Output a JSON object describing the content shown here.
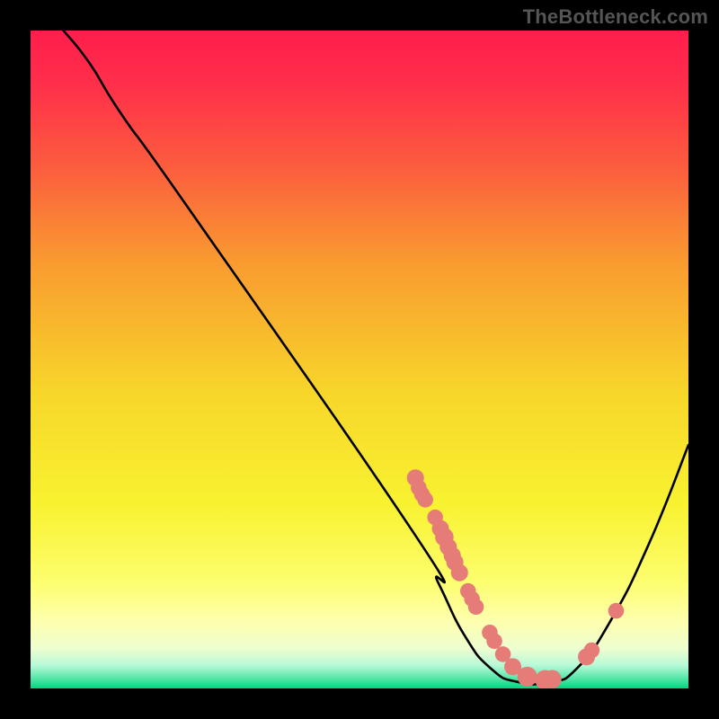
{
  "watermark": {
    "text": "TheBottleneck.com"
  },
  "colors": {
    "background": "#000000",
    "curve": "#000000",
    "marker_fill": "#E67C78",
    "marker_stroke": "#E67C78",
    "gradient_stops": [
      {
        "offset": 0.0,
        "color": "#FF1E4C"
      },
      {
        "offset": 0.08,
        "color": "#FF2E4A"
      },
      {
        "offset": 0.2,
        "color": "#FC5A3F"
      },
      {
        "offset": 0.35,
        "color": "#F99A30"
      },
      {
        "offset": 0.55,
        "color": "#F7D62A"
      },
      {
        "offset": 0.72,
        "color": "#F8F230"
      },
      {
        "offset": 0.84,
        "color": "#FDFE70"
      },
      {
        "offset": 0.9,
        "color": "#FEFFB0"
      },
      {
        "offset": 0.94,
        "color": "#EDFED0"
      },
      {
        "offset": 0.965,
        "color": "#B7F9D7"
      },
      {
        "offset": 0.985,
        "color": "#53E6A7"
      },
      {
        "offset": 1.0,
        "color": "#00D681"
      }
    ]
  },
  "chart_data": {
    "type": "line",
    "title": "",
    "xlabel": "",
    "ylabel": "",
    "xlim": [
      0,
      100
    ],
    "ylim": [
      0,
      100
    ],
    "grid": false,
    "legend": false,
    "curve": [
      {
        "x": 5,
        "y": 100
      },
      {
        "x": 9,
        "y": 95
      },
      {
        "x": 14,
        "y": 87
      },
      {
        "x": 24,
        "y": 73
      },
      {
        "x": 58,
        "y": 24
      },
      {
        "x": 62,
        "y": 16
      },
      {
        "x": 66,
        "y": 8
      },
      {
        "x": 70,
        "y": 3
      },
      {
        "x": 74,
        "y": 1
      },
      {
        "x": 79,
        "y": 1
      },
      {
        "x": 83,
        "y": 3
      },
      {
        "x": 88,
        "y": 10
      },
      {
        "x": 94,
        "y": 22
      },
      {
        "x": 100,
        "y": 37
      }
    ],
    "markers": [
      {
        "x": 58.5,
        "y": 32.0,
        "r": 1.3
      },
      {
        "x": 59.0,
        "y": 30.5,
        "r": 1.2
      },
      {
        "x": 59.5,
        "y": 29.5,
        "r": 1.2
      },
      {
        "x": 60.0,
        "y": 28.7,
        "r": 1.2
      },
      {
        "x": 61.5,
        "y": 26.0,
        "r": 1.2
      },
      {
        "x": 62.3,
        "y": 24.3,
        "r": 1.3
      },
      {
        "x": 62.9,
        "y": 23.0,
        "r": 1.4
      },
      {
        "x": 63.5,
        "y": 21.5,
        "r": 1.3
      },
      {
        "x": 64.1,
        "y": 20.2,
        "r": 1.3
      },
      {
        "x": 64.5,
        "y": 19.2,
        "r": 1.3
      },
      {
        "x": 65.2,
        "y": 17.6,
        "r": 1.3
      },
      {
        "x": 66.5,
        "y": 14.8,
        "r": 1.2
      },
      {
        "x": 67.1,
        "y": 13.6,
        "r": 1.2
      },
      {
        "x": 67.7,
        "y": 12.4,
        "r": 1.2
      },
      {
        "x": 69.8,
        "y": 8.5,
        "r": 1.2
      },
      {
        "x": 70.5,
        "y": 7.2,
        "r": 1.2
      },
      {
        "x": 71.8,
        "y": 5.2,
        "r": 1.2
      },
      {
        "x": 73.3,
        "y": 3.3,
        "r": 1.3
      },
      {
        "x": 75.5,
        "y": 1.8,
        "r": 1.5
      },
      {
        "x": 78.2,
        "y": 1.3,
        "r": 1.5
      },
      {
        "x": 79.3,
        "y": 1.4,
        "r": 1.4
      },
      {
        "x": 84.5,
        "y": 4.8,
        "r": 1.3
      },
      {
        "x": 85.3,
        "y": 5.8,
        "r": 1.2
      },
      {
        "x": 89.0,
        "y": 11.8,
        "r": 1.2
      }
    ]
  }
}
